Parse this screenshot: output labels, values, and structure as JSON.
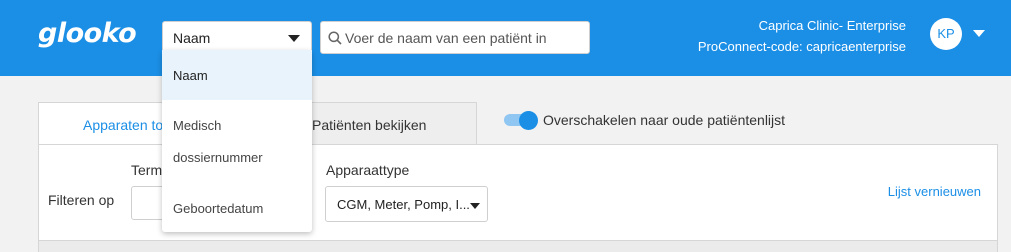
{
  "header": {
    "logo": "glooko",
    "search_type_value": "Naam",
    "search_placeholder": "Voer de naam van een patiënt in",
    "clinic_name": "Caprica Clinic- Enterprise",
    "proconnect_code": "ProConnect-code: capricaenterprise",
    "avatar_initials": "KP",
    "brand_color": "#1b8fe6"
  },
  "search_type_menu": {
    "options": [
      "Naam",
      "Medisch",
      "dossiernummer",
      "Geboortedatum"
    ],
    "selected": "Naam"
  },
  "tabs": [
    {
      "label": "Apparaten to"
    },
    {
      "label": "Patiënten bekijken"
    }
  ],
  "toggle": {
    "label": "Overschakelen naar oude patiëntenlijst",
    "on": true
  },
  "filters": {
    "filter_label": "Filteren op",
    "term_label": "Term",
    "device_type_label": "Apparaattype",
    "device_type_value": "CGM, Meter, Pomp, I...",
    "refresh_label": "Lijst vernieuwen"
  }
}
